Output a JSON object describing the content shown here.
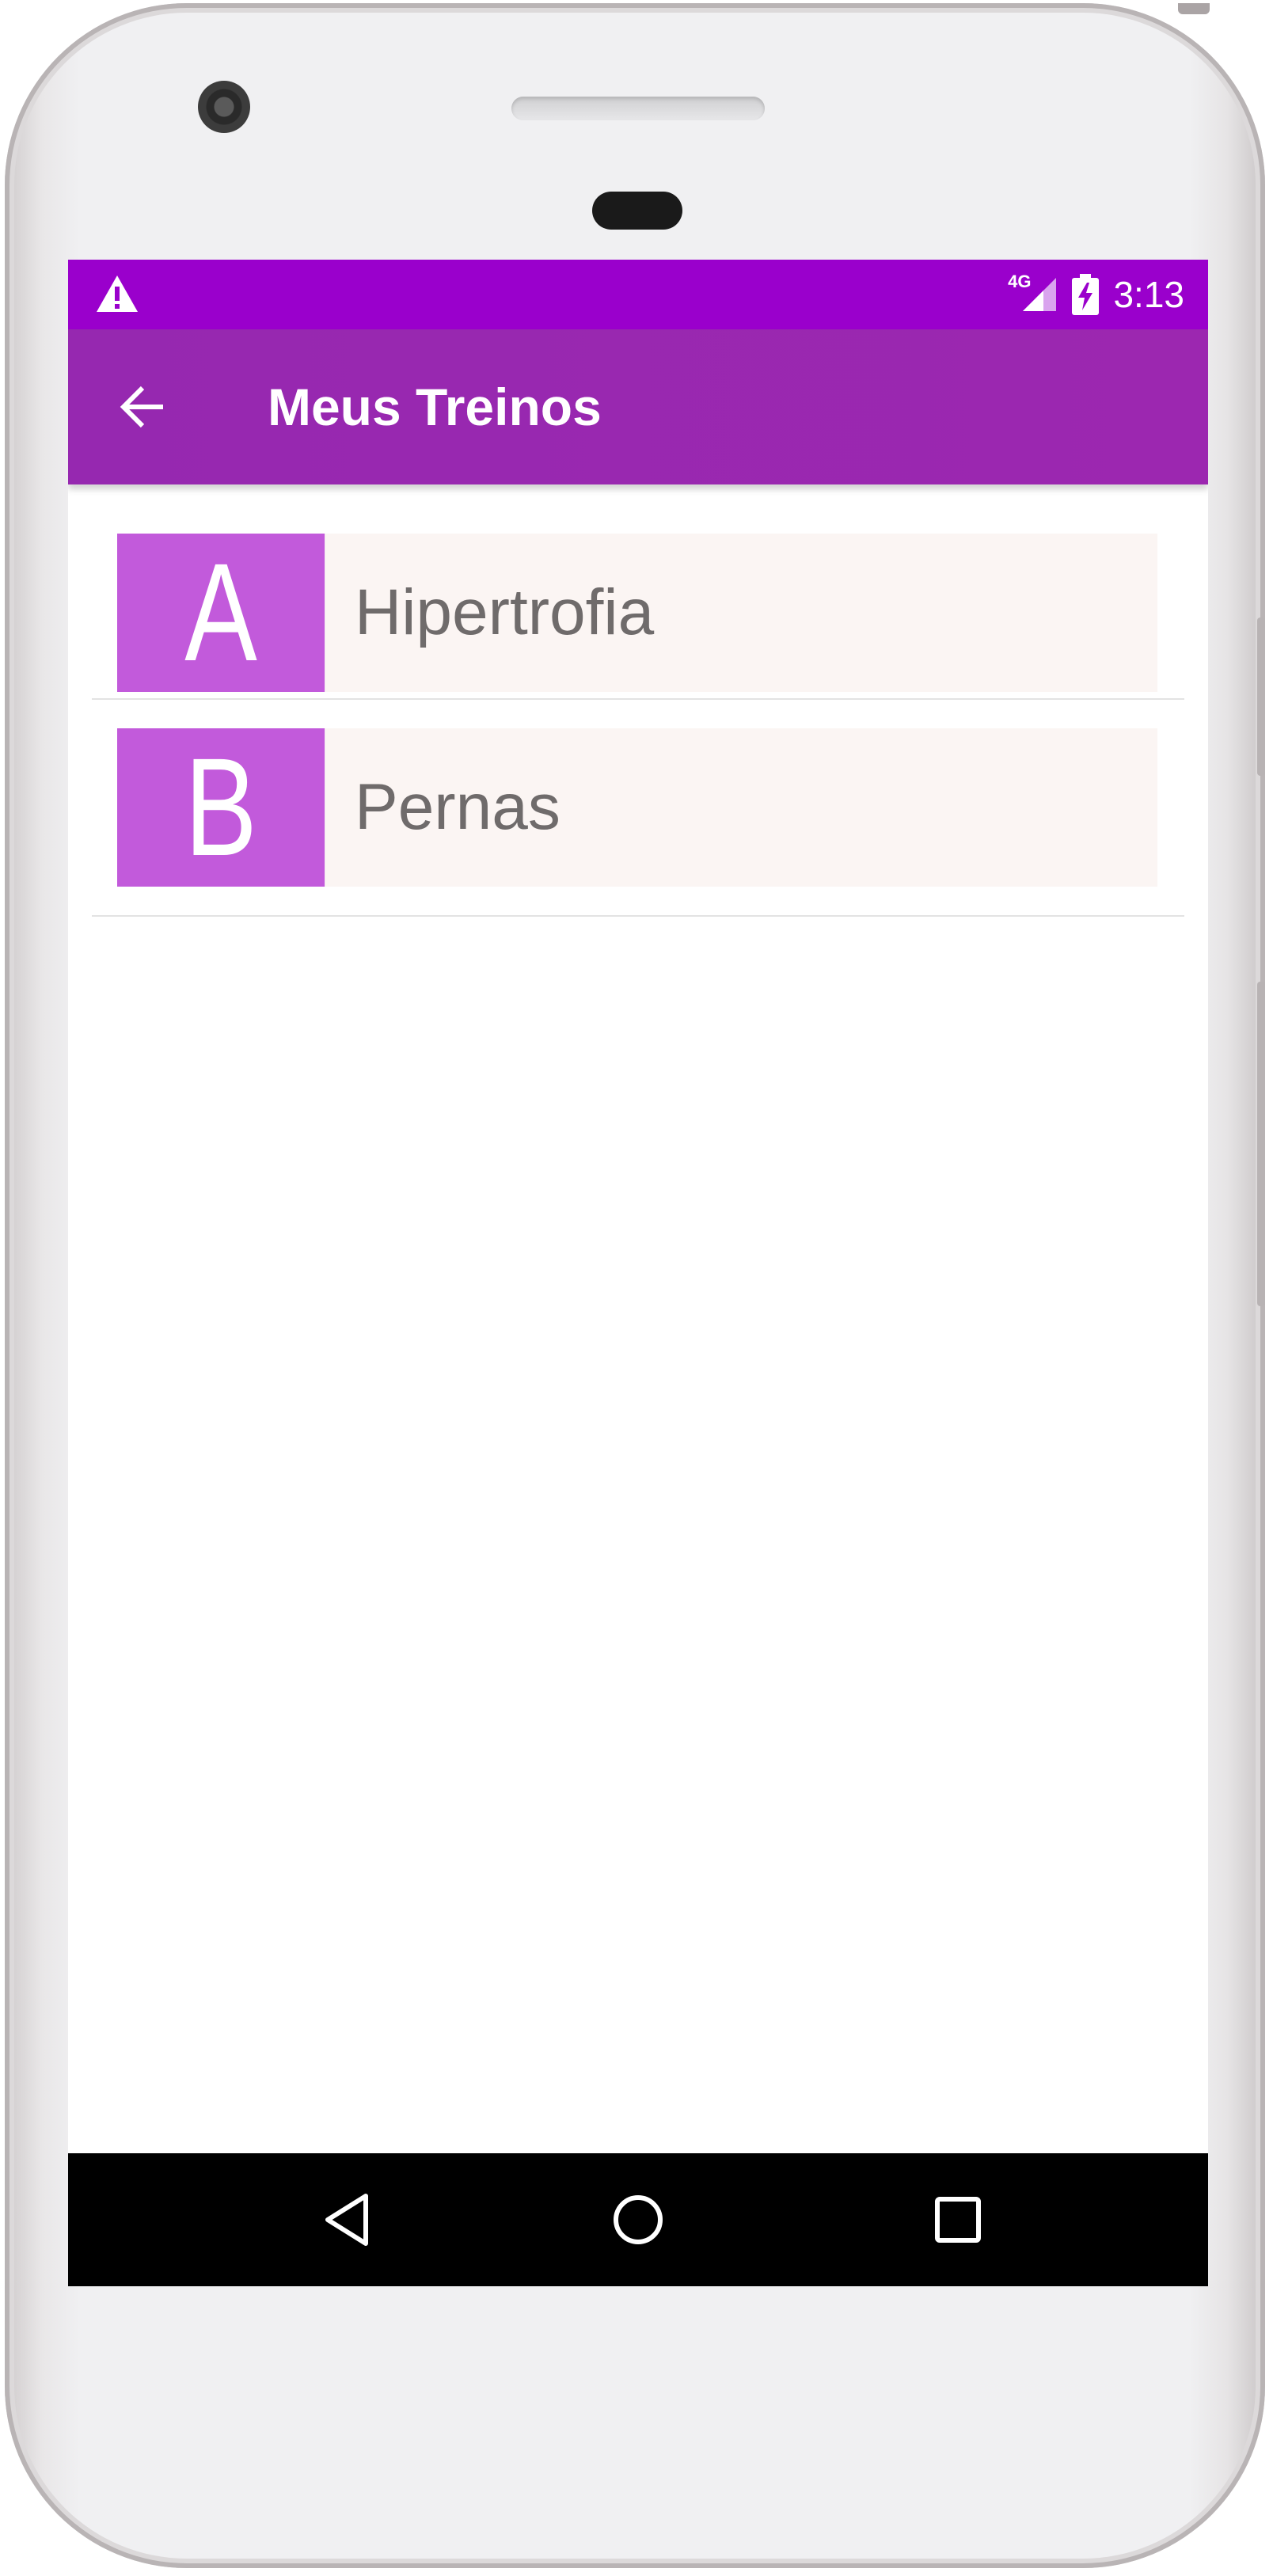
{
  "status_bar": {
    "warning_icon": "warning-triangle-icon",
    "network_label": "4G",
    "signal_icon": "signal-icon",
    "battery_icon": "battery-charging-icon",
    "time": "3:13"
  },
  "toolbar": {
    "back_icon": "arrow-back-icon",
    "title": "Meus Treinos",
    "color": "#9c27b0"
  },
  "workouts": [
    {
      "letter": "A",
      "name": "Hipertrofia"
    },
    {
      "letter": "B",
      "name": "Pernas"
    }
  ],
  "colors": {
    "status_bar": "#9a00cc",
    "badge": "#c25adb",
    "card_background": "#fbf5f3",
    "item_text": "#6f6b6b"
  },
  "nav_bar": {
    "back_icon": "nav-back-triangle-icon",
    "home_icon": "nav-home-circle-icon",
    "recents_icon": "nav-recents-square-icon"
  }
}
